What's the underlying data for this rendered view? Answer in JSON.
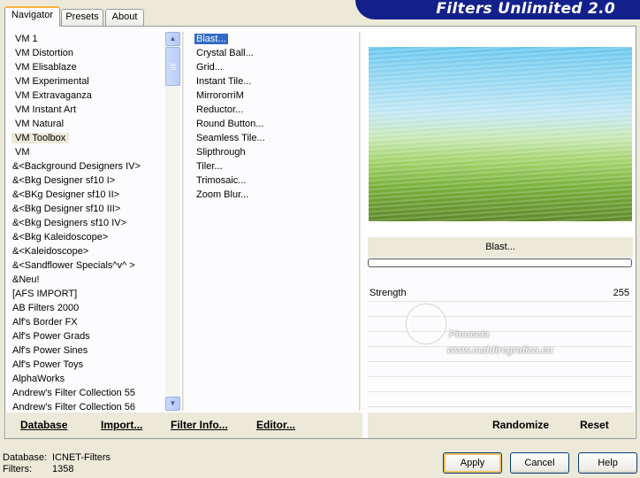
{
  "tabs": [
    {
      "label": "Navigator"
    },
    {
      "label": "Presets"
    },
    {
      "label": "About"
    }
  ],
  "logo_text": "Filters Unlimited 2.0",
  "categories": [
    "VM 1",
    "VM Distortion",
    "VM Elisablaze",
    "VM Experimental",
    "VM Extravaganza",
    "VM Instant Art",
    "VM Natural",
    "VM Toolbox",
    "VM",
    "&<Background Designers IV>",
    "&<Bkg Designer sf10 I>",
    "&<BKg Designer sf10 II>",
    "&<Bkg Designer sf10 III>",
    "&<Bkg Designers sf10 IV>",
    "&<Bkg Kaleidoscope>",
    "&<Kaleidoscope>",
    "&<Sandflower Specials^v^ >",
    "&Neu!",
    "[AFS IMPORT]",
    "AB Filters 2000",
    "Alf's Border FX",
    "Alf's Power Grads",
    "Alf's Power Sines",
    "Alf's Power Toys",
    "AlphaWorks",
    "Andrew's Filter Collection 55",
    "Andrew's Filter Collection 56"
  ],
  "selected_category": "VM Toolbox",
  "filters": [
    "Blast...",
    "Crystal Ball...",
    "Grid...",
    "Instant Tile...",
    "MirrororriM",
    "Reductor...",
    "Round Button...",
    "Seamless Tile...",
    "Slipthrough",
    "Tiler...",
    "Trimosaic...",
    "Zoom Blur..."
  ],
  "selected_filter": "Blast...",
  "preview_filter_name": "Blast...",
  "progress": 0,
  "sliders": [
    {
      "label": "Strength",
      "value": "255"
    }
  ],
  "watermark": {
    "line1": "Pinuccia",
    "line2": "www.maldiregrafica.eu"
  },
  "panel_buttons": {
    "database": "Database",
    "import": "Import...",
    "filter_info": "Filter Info...",
    "editor": "Editor...",
    "randomize": "Randomize",
    "reset": "Reset"
  },
  "status": {
    "database_label": "Database:",
    "database_value": "ICNET-Filters",
    "filters_label": "Filters:",
    "filters_value": "1358"
  },
  "dialog_buttons": {
    "apply": "Apply",
    "cancel": "Cancel",
    "help": "Help"
  },
  "colors": {
    "selection": "#316ac5",
    "logo_bg": "#14218c",
    "tab_highlight": "#f9b33c"
  }
}
